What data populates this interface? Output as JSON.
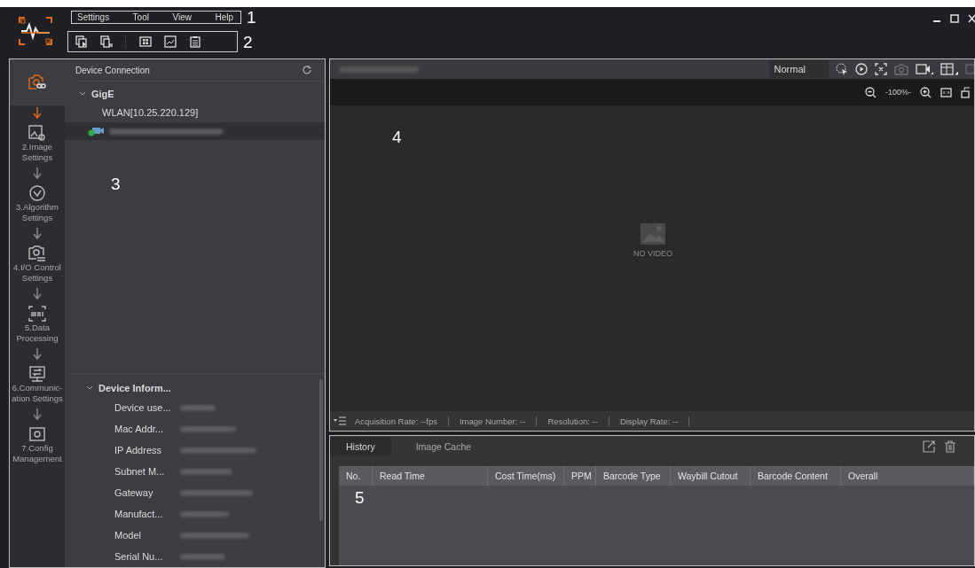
{
  "menu": [
    "Settings",
    "Tool",
    "View",
    "Help"
  ],
  "callouts": [
    "1",
    "2",
    "3",
    "4",
    "5"
  ],
  "steps": [
    {
      "selected": true
    },
    {
      "label": "2.Image Settings",
      "selected": false
    },
    {
      "label": "3.Algorithm Settings",
      "selected": false
    },
    {
      "label": "4.I/O Control Settings",
      "selected": false
    },
    {
      "label": "5.Data Processing",
      "selected": false
    },
    {
      "label": "6.Communic-ation Settings",
      "selected": false
    },
    {
      "label": "7.Config Management",
      "selected": false
    }
  ],
  "device_connection": {
    "title": "Device Connection",
    "tree": [
      {
        "label": "GigE",
        "expanded": true,
        "children": [
          {
            "kind": "interface",
            "label": "WLAN[10.25.220.129]",
            "selected": false
          },
          {
            "kind": "device",
            "selected": true
          }
        ]
      }
    ]
  },
  "device_info": {
    "title": "Device Inform...",
    "expanded": true,
    "fields": [
      "Device use...",
      "Mac Addr...",
      "IP Address",
      "Subnet M...",
      "Gateway",
      "Manufact...",
      "Model",
      "Serial Nu..."
    ]
  },
  "viewer": {
    "mode": "Normal",
    "zoom": "-100%-",
    "placeholder": "NO VIDEO"
  },
  "status_bar": [
    "Acquisition Rate: --fps",
    "Image Number: --",
    "Resolution: --",
    "Display Rate: --"
  ],
  "history": {
    "tabs": [
      {
        "label": "History",
        "selected": true
      },
      {
        "label": "Image Cache",
        "selected": false
      }
    ],
    "columns": [
      "No.",
      "Read Time",
      "Cost Time(ms)",
      "PPM",
      "Barcode Type",
      "Waybill Cutout",
      "Barcode Content",
      "Overall"
    ]
  }
}
